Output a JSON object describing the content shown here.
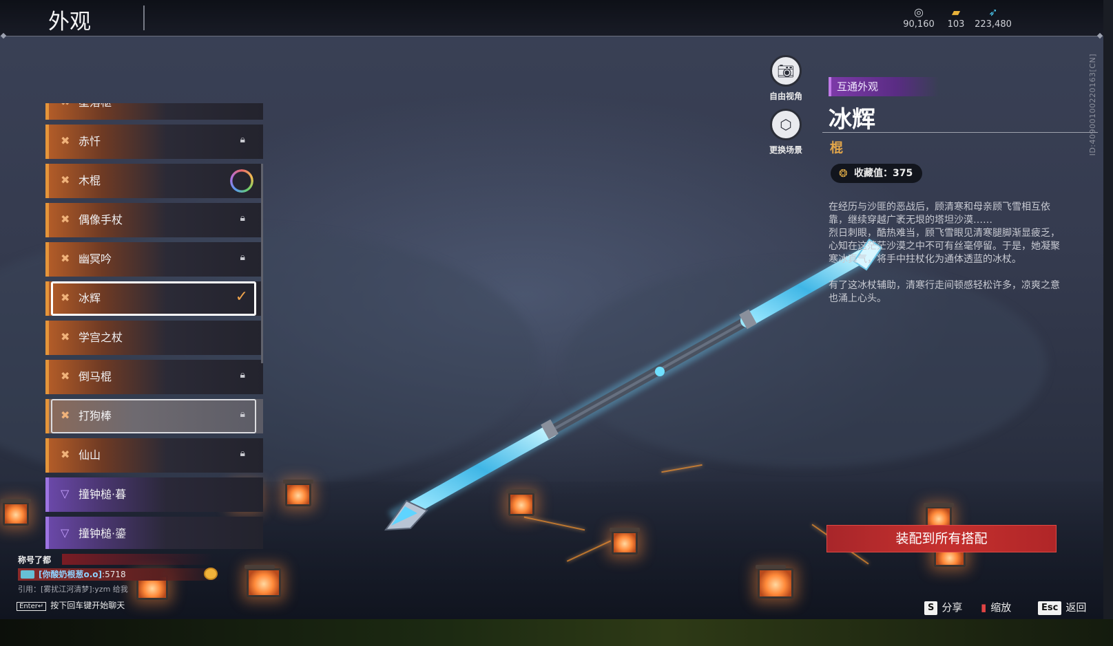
{
  "header": {
    "title": "外观",
    "currencies": [
      {
        "icon": "silver-coin-icon",
        "value": "90,160"
      },
      {
        "icon": "gold-ticket-icon",
        "value": "103"
      },
      {
        "icon": "blue-feather-icon",
        "value": "223,480"
      }
    ]
  },
  "client_id": "ID:4090010022​0163[CN]",
  "list": {
    "items": [
      {
        "label": "星落枢",
        "state": "locked",
        "rarity": "orange"
      },
      {
        "label": "赤忏",
        "state": "locked",
        "rarity": "orange"
      },
      {
        "label": "木棍",
        "state": "ring",
        "rarity": "orange"
      },
      {
        "label": "偶像手杖",
        "state": "locked",
        "rarity": "orange"
      },
      {
        "label": "幽冥吟",
        "state": "locked",
        "rarity": "orange"
      },
      {
        "label": "冰辉",
        "state": "equipped",
        "rarity": "orange"
      },
      {
        "label": "学宫之杖",
        "state": "none",
        "rarity": "orange"
      },
      {
        "label": "倒马棍",
        "state": "locked",
        "rarity": "orange"
      },
      {
        "label": "打狗棒",
        "state": "locked",
        "rarity": "orange"
      },
      {
        "label": "仙山",
        "state": "locked",
        "rarity": "orange"
      },
      {
        "label": "撞钟槌·暮",
        "state": "none",
        "rarity": "purple"
      },
      {
        "label": "撞钟槌·鎏",
        "state": "none",
        "rarity": "purple"
      }
    ]
  },
  "side_buttons": {
    "free_view": "自由视角",
    "change_scene": "更换场景"
  },
  "detail": {
    "tag": "互通外观",
    "name": "冰辉",
    "type": "棍",
    "collect_value": "收藏值：375",
    "desc_1": "在经历与沙匪的恶战后，顾清寒和母亲顾飞雪相互依靠，继续穿越广袤无垠的塔坦沙漠……",
    "desc_2": "烈日刺眼，酷热难当，顾飞雪眼见清寒腿脚渐显疲乏，心知在这茫茫沙漠之中不可有丝毫停留。于是，她凝聚寒冰真气，将手中拄杖化为通体透蓝的冰杖。",
    "desc_3": "有了这冰杖辅助，清寒行走间顿感轻松许多，凉爽之意也涌上心头。",
    "equip_all": "装配到所有搭配"
  },
  "hints": [
    {
      "key": "S",
      "label": "分享"
    },
    {
      "key": "mouse",
      "label": "缩放"
    },
    {
      "key": "Esc",
      "label": "返回"
    }
  ],
  "chat": {
    "header": "称号了都",
    "sender": "[你酸奶根葱o.o]",
    "message": ":5718",
    "quote": "引用：[雾扰江河清梦]:yzm 给我",
    "enter_key": "Enter↵",
    "enter_hint": "按下回车键开始聊天"
  },
  "colors": {
    "accent_orange": "#e5953a",
    "accent_purple": "#9d74e2",
    "equip_red": "#c5302e",
    "type_gold": "#e1a54a"
  }
}
